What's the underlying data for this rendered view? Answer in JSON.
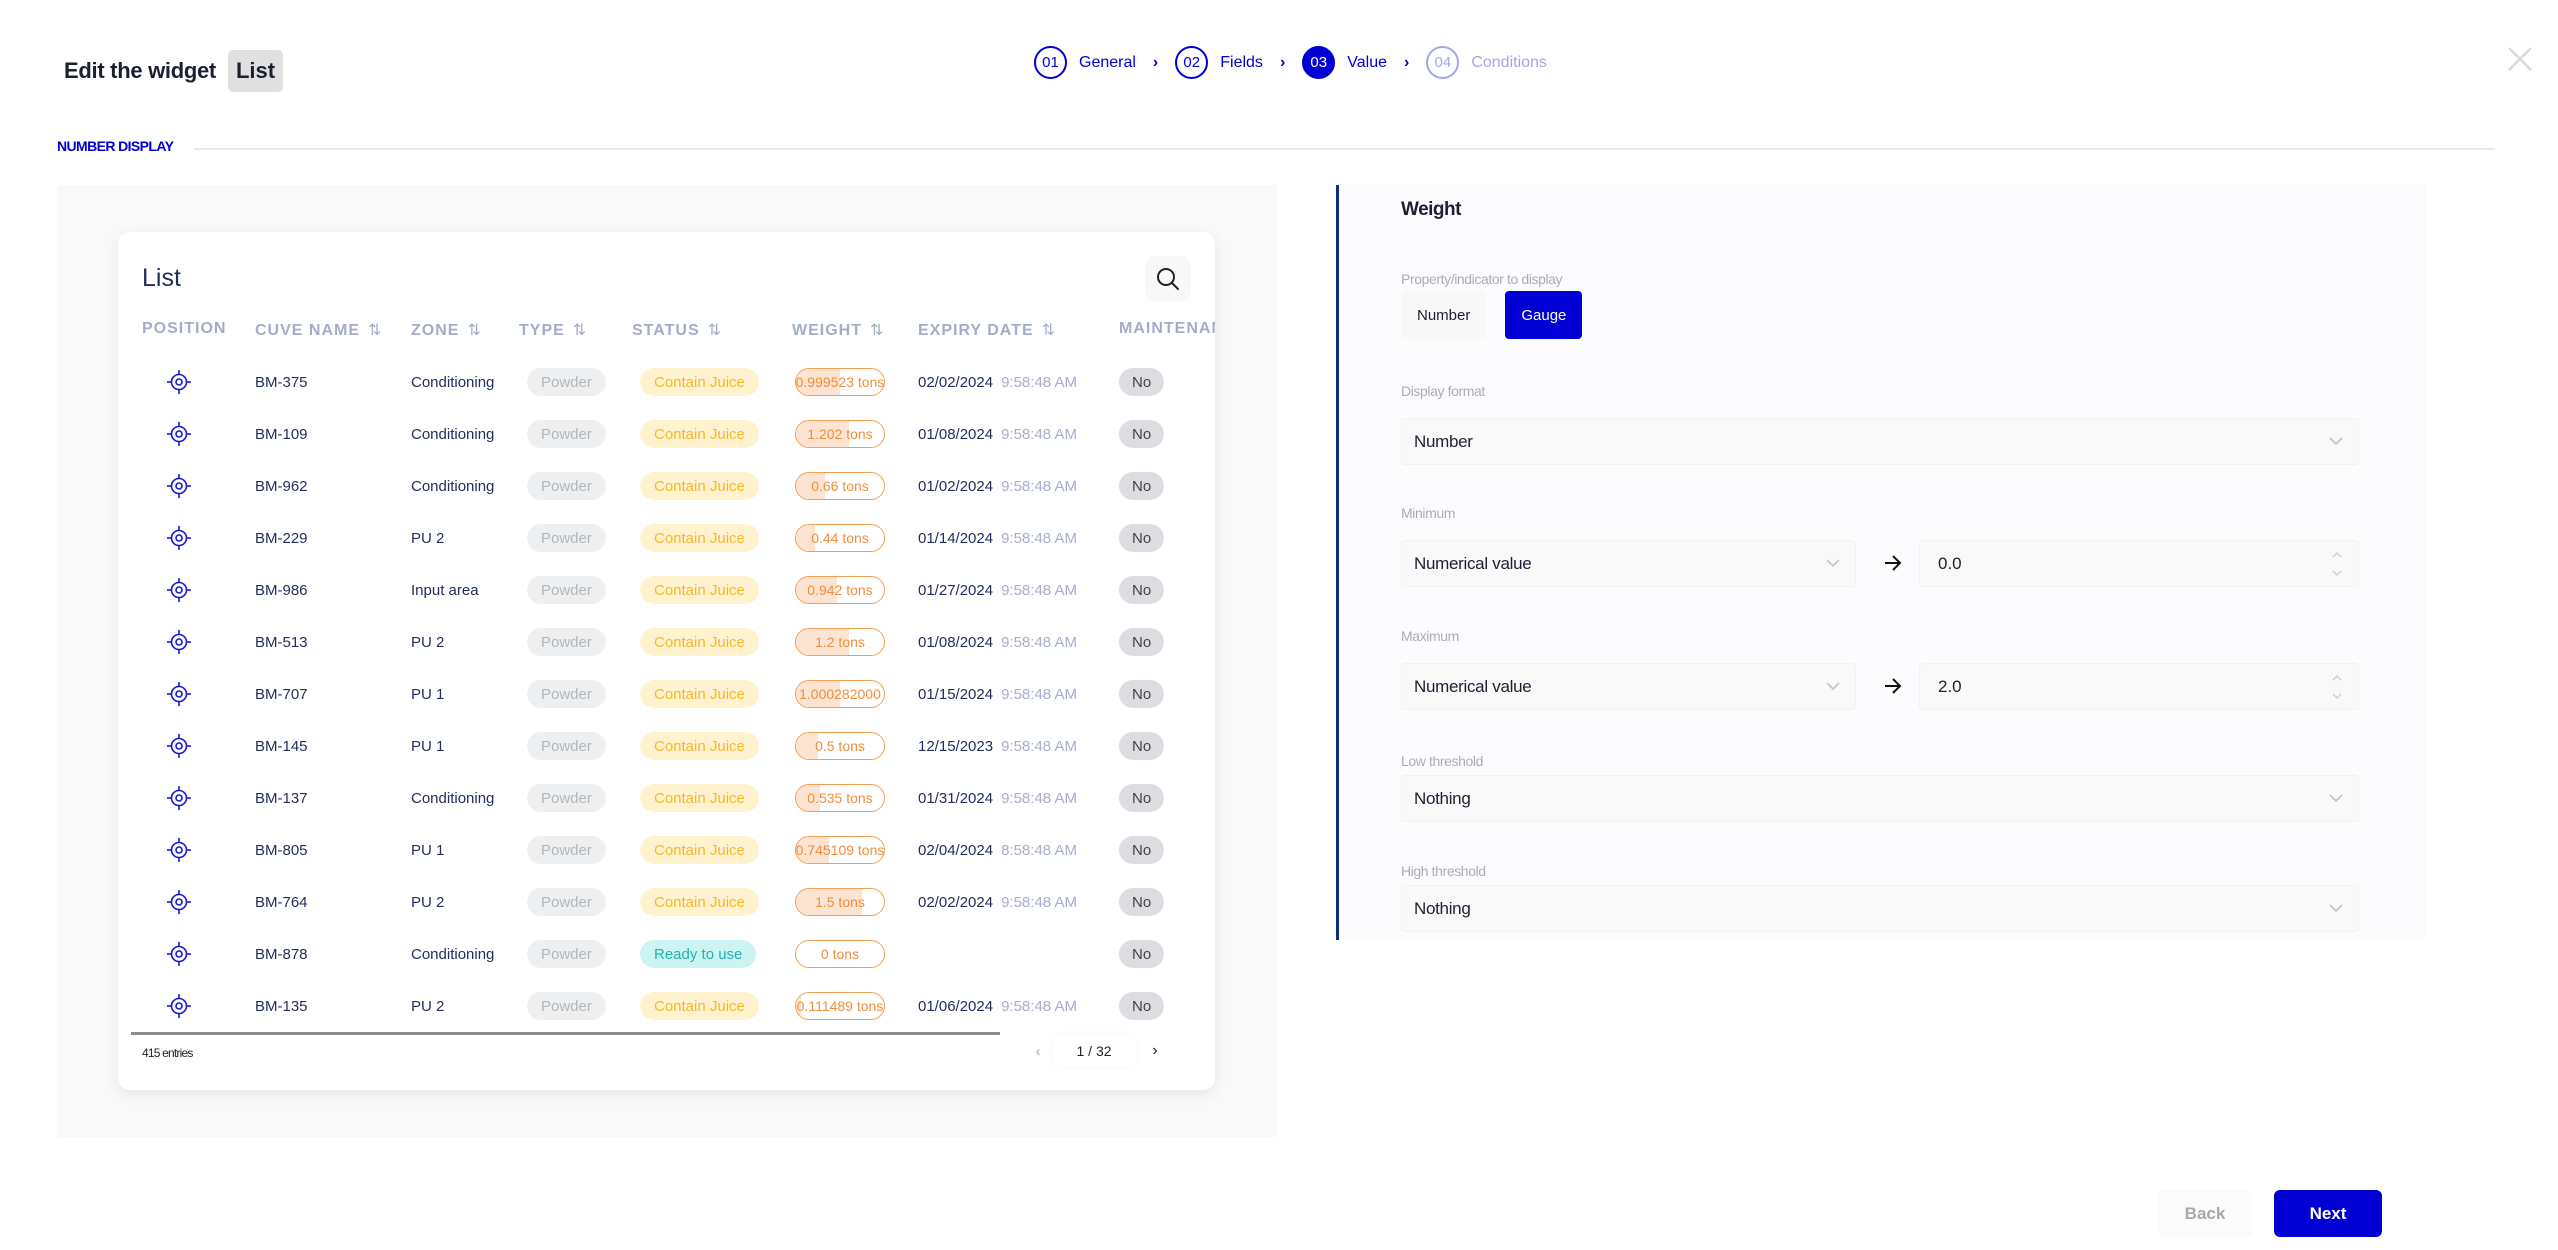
{
  "header": {
    "title": "Edit the widget",
    "widget_type_badge": "List",
    "close_icon": "close-icon"
  },
  "stepper": {
    "steps": [
      {
        "num": "01",
        "label": "General",
        "state": "done"
      },
      {
        "num": "02",
        "label": "Fields",
        "state": "done"
      },
      {
        "num": "03",
        "label": "Value",
        "state": "active"
      },
      {
        "num": "04",
        "label": "Conditions",
        "state": "disabled"
      }
    ],
    "separator_icon": "chevron-right-icon"
  },
  "section": {
    "title": "NUMBER DISPLAY"
  },
  "preview": {
    "card_title": "List",
    "search_icon": "search-icon",
    "columns": [
      {
        "label": "POSITION",
        "sortable": false
      },
      {
        "label": "CUVE NAME",
        "sortable": true
      },
      {
        "label": "ZONE",
        "sortable": true
      },
      {
        "label": "TYPE",
        "sortable": true
      },
      {
        "label": "STATUS",
        "sortable": true
      },
      {
        "label": "WEIGHT",
        "sortable": true
      },
      {
        "label": "EXPIRY DATE",
        "sortable": true
      },
      {
        "label": "MAINTENAN",
        "sortable": false
      }
    ],
    "sort_glyph": "⇅",
    "rows": [
      {
        "name": "BM-375",
        "zone": "Conditioning",
        "type": "Powder",
        "status": "Contain Juice",
        "status_kind": "juice",
        "weight": "0.999523 tons",
        "weight_fraction": 0.5,
        "date": "02/02/2024",
        "time": "9:58:48 AM",
        "maintenance": "No"
      },
      {
        "name": "BM-109",
        "zone": "Conditioning",
        "type": "Powder",
        "status": "Contain Juice",
        "status_kind": "juice",
        "weight": "1.202 tons",
        "weight_fraction": 0.6,
        "date": "01/08/2024",
        "time": "9:58:48 AM",
        "maintenance": "No"
      },
      {
        "name": "BM-962",
        "zone": "Conditioning",
        "type": "Powder",
        "status": "Contain Juice",
        "status_kind": "juice",
        "weight": "0.66 tons",
        "weight_fraction": 0.33,
        "date": "01/02/2024",
        "time": "9:58:48 AM",
        "maintenance": "No"
      },
      {
        "name": "BM-229",
        "zone": "PU 2",
        "type": "Powder",
        "status": "Contain Juice",
        "status_kind": "juice",
        "weight": "0.44 tons",
        "weight_fraction": 0.22,
        "date": "01/14/2024",
        "time": "9:58:48 AM",
        "maintenance": "No"
      },
      {
        "name": "BM-986",
        "zone": "Input area",
        "type": "Powder",
        "status": "Contain Juice",
        "status_kind": "juice",
        "weight": "0.942 tons",
        "weight_fraction": 0.47,
        "date": "01/27/2024",
        "time": "9:58:48 AM",
        "maintenance": "No"
      },
      {
        "name": "BM-513",
        "zone": "PU 2",
        "type": "Powder",
        "status": "Contain Juice",
        "status_kind": "juice",
        "weight": "1.2 tons",
        "weight_fraction": 0.6,
        "date": "01/08/2024",
        "time": "9:58:48 AM",
        "maintenance": "No"
      },
      {
        "name": "BM-707",
        "zone": "PU 1",
        "type": "Powder",
        "status": "Contain Juice",
        "status_kind": "juice",
        "weight": "1.000282000",
        "weight_fraction": 0.5,
        "date": "01/15/2024",
        "time": "9:58:48 AM",
        "maintenance": "No"
      },
      {
        "name": "BM-145",
        "zone": "PU 1",
        "type": "Powder",
        "status": "Contain Juice",
        "status_kind": "juice",
        "weight": "0.5 tons",
        "weight_fraction": 0.25,
        "date": "12/15/2023",
        "time": "9:58:48 AM",
        "maintenance": "No"
      },
      {
        "name": "BM-137",
        "zone": "Conditioning",
        "type": "Powder",
        "status": "Contain Juice",
        "status_kind": "juice",
        "weight": "0.535 tons",
        "weight_fraction": 0.27,
        "date": "01/31/2024",
        "time": "9:58:48 AM",
        "maintenance": "No"
      },
      {
        "name": "BM-805",
        "zone": "PU 1",
        "type": "Powder",
        "status": "Contain Juice",
        "status_kind": "juice",
        "weight": "0.745109 tons",
        "weight_fraction": 0.37,
        "date": "02/04/2024",
        "time": "8:58:48 AM",
        "maintenance": "No"
      },
      {
        "name": "BM-764",
        "zone": "PU 2",
        "type": "Powder",
        "status": "Contain Juice",
        "status_kind": "juice",
        "weight": "1.5 tons",
        "weight_fraction": 0.75,
        "date": "02/02/2024",
        "time": "9:58:48 AM",
        "maintenance": "No"
      },
      {
        "name": "BM-878",
        "zone": "Conditioning",
        "type": "Powder",
        "status": "Ready to use",
        "status_kind": "ready",
        "weight": "0 tons",
        "weight_fraction": 0,
        "date": "",
        "time": "",
        "maintenance": "No"
      },
      {
        "name": "BM-135",
        "zone": "PU 2",
        "type": "Powder",
        "status": "Contain Juice",
        "status_kind": "juice",
        "weight": "0.111489 tons",
        "weight_fraction": 0.06,
        "date": "01/06/2024",
        "time": "9:58:48 AM",
        "maintenance": "No"
      }
    ],
    "entries_label": "415 entries",
    "pagination": {
      "current": "1 / 32",
      "prev_icon": "chevron-left-icon",
      "next_icon": "chevron-right-icon"
    }
  },
  "form": {
    "title": "Weight",
    "property_label": "Property/indicator to display",
    "property_options": [
      {
        "label": "Number",
        "selected": false
      },
      {
        "label": "Gauge",
        "selected": true
      }
    ],
    "display_format": {
      "label": "Display format",
      "value": "Number"
    },
    "minimum": {
      "label": "Minimum",
      "source": "Numerical value",
      "value": "0.0"
    },
    "maximum": {
      "label": "Maximum",
      "source": "Numerical value",
      "value": "2.0"
    },
    "low_threshold": {
      "label": "Low threshold",
      "value": "Nothing"
    },
    "high_threshold": {
      "label": "High threshold",
      "value": "Nothing"
    }
  },
  "footer": {
    "back_label": "Back",
    "next_label": "Next"
  },
  "colors": {
    "accent": "#0000d4",
    "panel_border": "#10307a",
    "juice_bg": "#fff3cf",
    "juice_fg": "#f9b82c",
    "ready_bg": "#ccf4f2",
    "ready_fg": "#22b3b0",
    "weight_border": "#f0a053"
  }
}
